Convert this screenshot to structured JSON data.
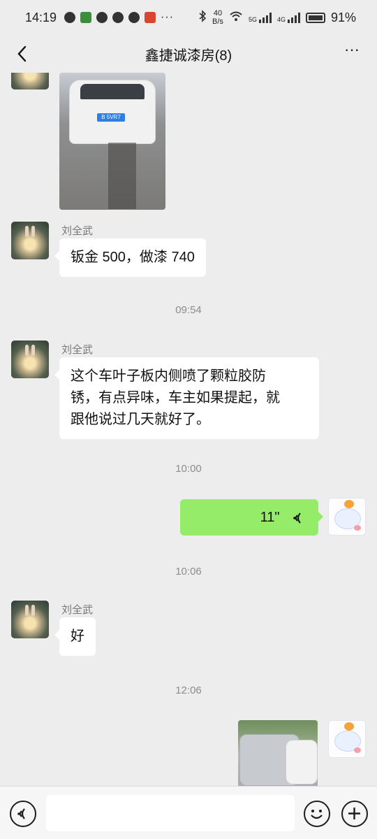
{
  "status_bar": {
    "time": "14:19",
    "net_speed_top": "40",
    "net_speed_bottom": "B/s",
    "signal_1_label": "5G",
    "signal_2_label": "4G",
    "battery_percent": "91%",
    "dots": "···"
  },
  "header": {
    "title": "鑫捷诚漆房(8)",
    "more_label": "···"
  },
  "messages": [
    {
      "type": "image",
      "side": "left",
      "plate_text": "B 5VR7"
    },
    {
      "type": "text",
      "side": "left",
      "sender": "刘全武",
      "text": "钣金 500，做漆 740"
    },
    {
      "type": "time",
      "text": "09:54"
    },
    {
      "type": "text",
      "side": "left",
      "sender": "刘全武",
      "lines": [
        "这个车叶子板内侧喷了颗粒胶防",
        "锈，有点异味，车主如果提起，就",
        "跟他说过几天就好了。"
      ]
    },
    {
      "type": "time",
      "text": "10:00"
    },
    {
      "type": "voice",
      "side": "right",
      "duration": "11\""
    },
    {
      "type": "time",
      "text": "10:06"
    },
    {
      "type": "text",
      "side": "left",
      "sender": "刘全武",
      "text": "好"
    },
    {
      "type": "time",
      "text": "12:06"
    },
    {
      "type": "image",
      "side": "right"
    }
  ],
  "input_bar": {
    "placeholder": ""
  },
  "colors": {
    "background": "#ededed",
    "bubble_self": "#95ec69",
    "bubble_other": "#ffffff"
  }
}
